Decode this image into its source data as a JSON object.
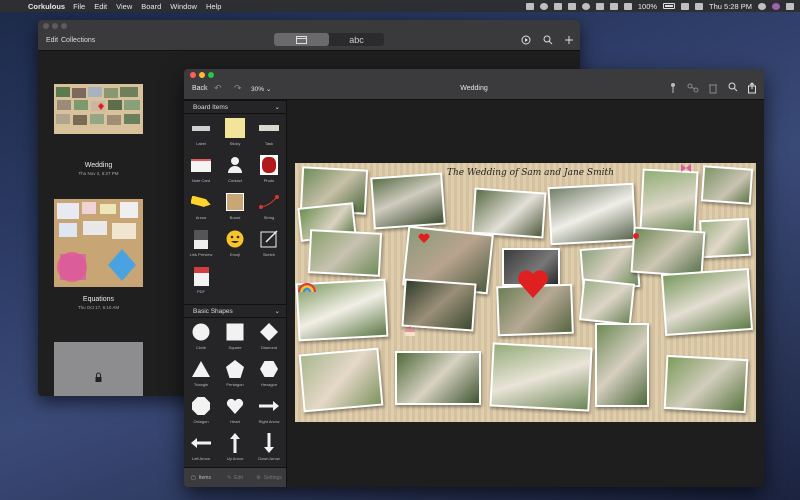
{
  "menubar": {
    "app_name": "Corkulous",
    "menus": [
      "File",
      "Edit",
      "View",
      "Board",
      "Window",
      "Help"
    ],
    "battery": "100%",
    "clock": "Thu 5:28 PM"
  },
  "back_window": {
    "menus": [
      "Edit",
      "Collections"
    ],
    "segment": [
      "abc"
    ],
    "boards": [
      {
        "name": "Wedding",
        "date": "Thu Nov 2, 6:27 PM"
      },
      {
        "name": "Equations",
        "date": "Thu Oct 17, 6:10 AM"
      }
    ]
  },
  "front_window": {
    "back_label": "Back",
    "zoom": "30%",
    "title": "Wedding",
    "sidebar": {
      "board_items_title": "Board Items",
      "board_items": [
        {
          "label": "Label",
          "icon": "label-icon"
        },
        {
          "label": "Sticky",
          "icon": "sticky-icon"
        },
        {
          "label": "Task",
          "icon": "task-icon"
        },
        {
          "label": "Note Card",
          "icon": "note-card-icon"
        },
        {
          "label": "Contact",
          "icon": "contact-icon"
        },
        {
          "label": "Photo",
          "icon": "photo-icon"
        },
        {
          "label": "Arrow",
          "icon": "arrow-icon"
        },
        {
          "label": "Board",
          "icon": "board-icon"
        },
        {
          "label": "String",
          "icon": "string-icon"
        },
        {
          "label": "Link Preview",
          "icon": "link-preview-icon"
        },
        {
          "label": "Emoji",
          "icon": "emoji-icon"
        },
        {
          "label": "Sketch",
          "icon": "sketch-icon"
        },
        {
          "label": "PDF",
          "icon": "pdf-icon"
        }
      ],
      "basic_shapes_title": "Basic Shapes",
      "basic_shapes": [
        {
          "label": "Circle",
          "icon": "circle-icon"
        },
        {
          "label": "Square",
          "icon": "square-icon"
        },
        {
          "label": "Diamond",
          "icon": "diamond-icon"
        },
        {
          "label": "Triangle",
          "icon": "triangle-icon"
        },
        {
          "label": "Pentagon",
          "icon": "pentagon-icon"
        },
        {
          "label": "Hexagon",
          "icon": "hexagon-icon"
        },
        {
          "label": "Octagon",
          "icon": "octagon-icon"
        },
        {
          "label": "Heart",
          "icon": "heart-icon"
        },
        {
          "label": "Right Arrow",
          "icon": "right-arrow-icon"
        },
        {
          "label": "Left Arrow",
          "icon": "left-arrow-icon"
        },
        {
          "label": "Up Arrow",
          "icon": "up-arrow-icon"
        },
        {
          "label": "Down Arrow",
          "icon": "down-arrow-icon"
        }
      ],
      "tabs": [
        "Items",
        "Edit",
        "Settings"
      ]
    },
    "board": {
      "heading": "The Wedding of Sam and Jane Smith",
      "accent": "#e02020"
    }
  }
}
